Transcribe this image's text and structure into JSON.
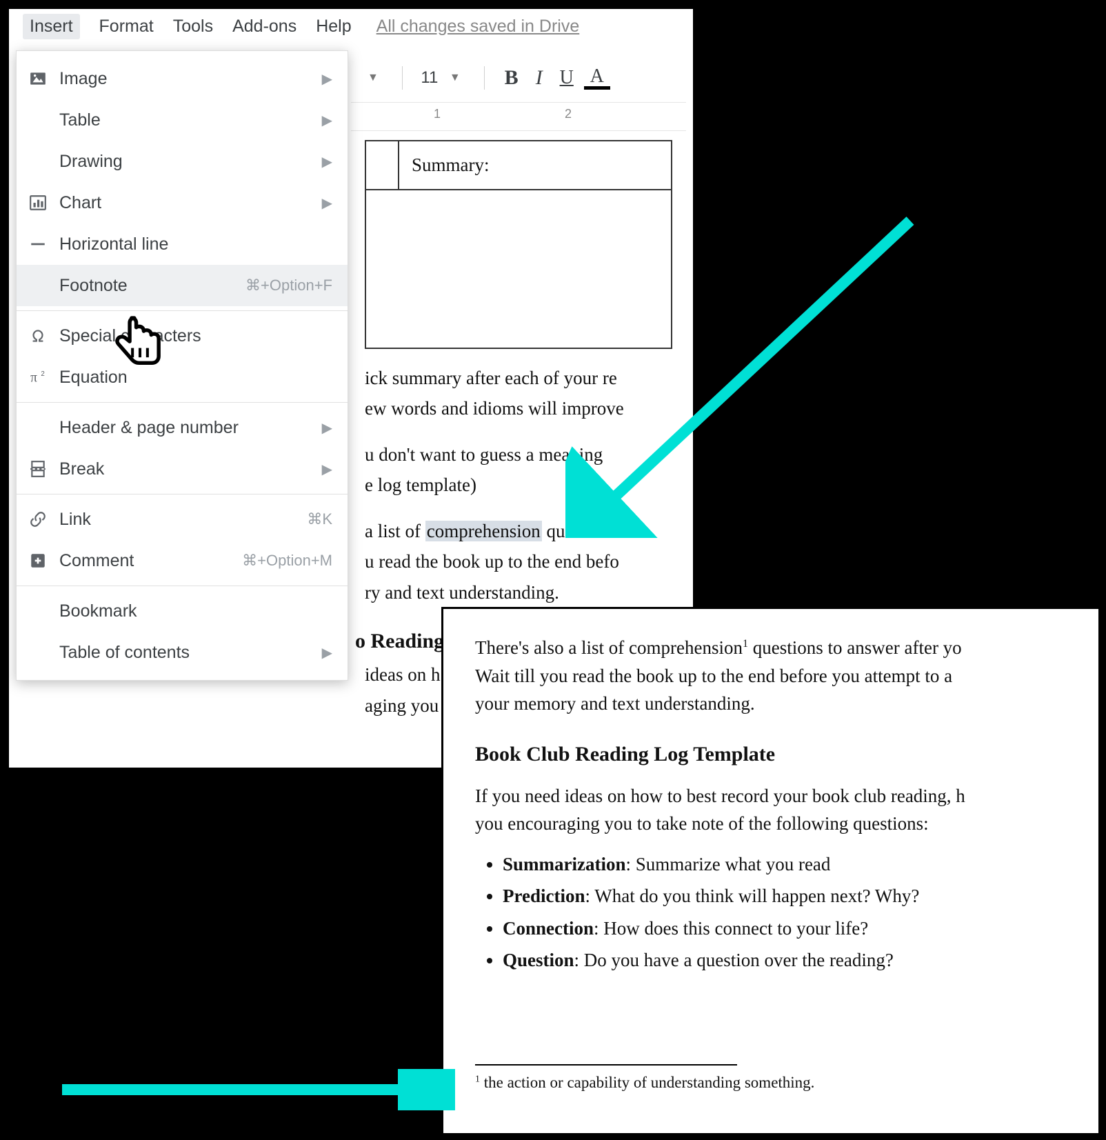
{
  "menubar": {
    "insert": "Insert",
    "format": "Format",
    "tools": "Tools",
    "addons": "Add-ons",
    "help": "Help",
    "saved": "All changes saved in Drive"
  },
  "dropdown": {
    "image": "Image",
    "table": "Table",
    "drawing": "Drawing",
    "chart": "Chart",
    "hline": "Horizontal line",
    "footnote": "Footnote",
    "footnote_kbd": "⌘+Option+F",
    "special": "Special characters",
    "equation": "Equation",
    "header": "Header & page number",
    "break": "Break",
    "link": "Link",
    "link_kbd": "⌘K",
    "comment": "Comment",
    "comment_kbd": "⌘+Option+M",
    "bookmark": "Bookmark",
    "toc": "Table of contents"
  },
  "toolbar": {
    "fontsize": "11",
    "bold": "B",
    "italic": "I",
    "underline": "U",
    "textcolor": "A"
  },
  "ruler": {
    "n1": "1",
    "n2": "2"
  },
  "doc1": {
    "summary_label": "Summary:",
    "p1a": "ick summary after each of your re",
    "p1b": "ew words and idioms will improve",
    "p2a": "u don't want to guess a meaning",
    "p2b": "e log template)",
    "p3a_pre": " a list of ",
    "p3a_hl": "comprehension",
    "p3a_post": " questions",
    "p3b": "u read the book up to the end befo",
    "p3c": "ry and text understanding.",
    "h": "o Reading",
    "p4a": "ideas on h",
    "p4b": "aging you"
  },
  "doc2": {
    "p1": "There's also a list of comprehension",
    "p1_post": " questions to answer after yo",
    "p2": "Wait till you read the book up to the end before you attempt to a",
    "p3": "your memory and text understanding.",
    "h": "Book Club Reading Log Template",
    "p4": "If you need ideas on how to best record your book club reading, h",
    "p5": "you encouraging you to take note of the following questions:",
    "li1b": "Summarization",
    "li1": ": Summarize what you read",
    "li2b": "Prediction",
    "li2": ": What do you think will happen next? Why?",
    "li3b": "Connection",
    "li3": ": How does this connect to your life?",
    "li4b": "Question",
    "li4": ": Do you have a question over the reading?",
    "fn_num": "1",
    "fn_text": " the action or capability of understanding something."
  }
}
